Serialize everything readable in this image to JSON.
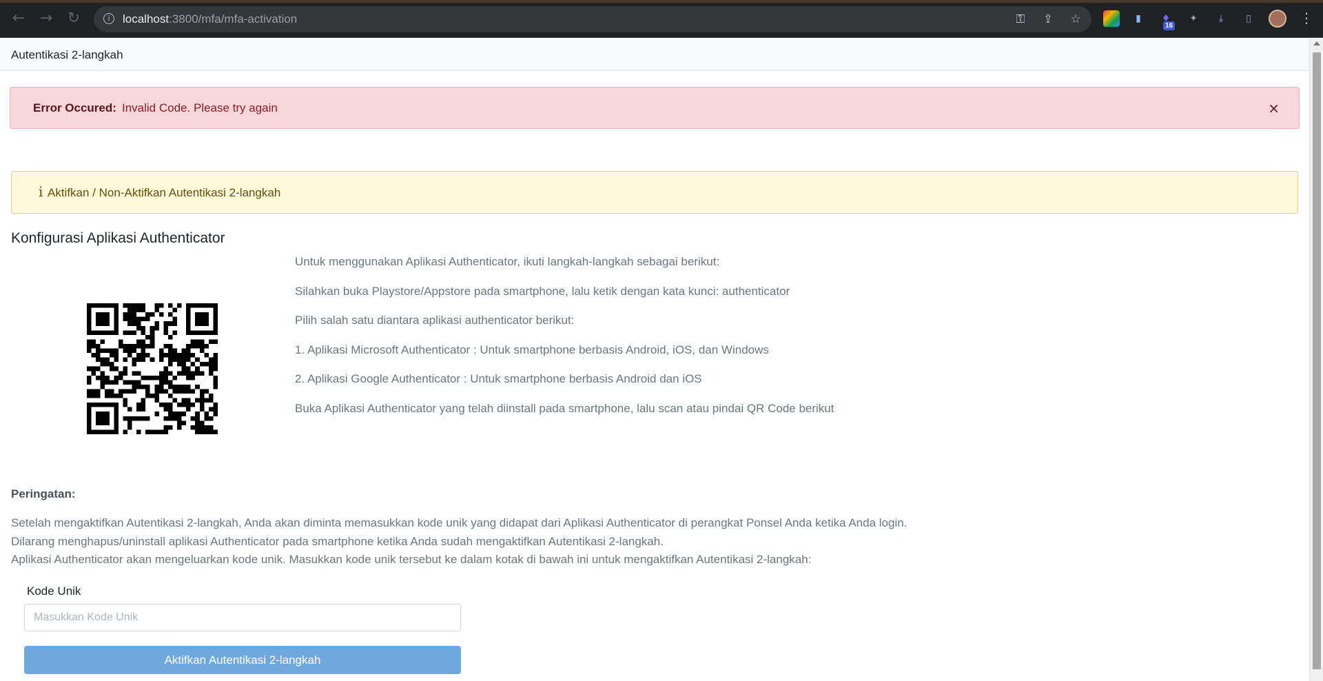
{
  "browser": {
    "url_host": "localhost",
    "url_rest": ":3800/mfa/mfa-activation",
    "extension_badge": "16"
  },
  "navbar": {
    "brand": "Autentikasi 2-langkah"
  },
  "error_alert": {
    "label": "Error Occured:",
    "message": "Invalid Code. Please try again",
    "close": "×"
  },
  "info_alert": {
    "icon": "i",
    "text": "Aktifkan / Non-Aktifkan Autentikasi 2-langkah"
  },
  "config": {
    "title": "Konfigurasi Aplikasi Authenticator",
    "instructions": [
      "Untuk menggunakan Aplikasi Authenticator, ikuti langkah-langkah sebagai berikut:",
      "Silahkan buka Playstore/Appstore pada smartphone, lalu ketik dengan kata kunci: authenticator",
      "Pilih salah satu diantara aplikasi authenticator berikut:",
      "1. Aplikasi Microsoft Authenticator : Untuk smartphone berbasis Android, iOS, dan Windows",
      "2. Aplikasi Google Authenticator : Untuk smartphone berbasis Android dan iOS",
      "Buka Aplikasi Authenticator yang telah diinstall pada smartphone, lalu scan atau pindai QR Code berikut"
    ]
  },
  "warning": {
    "title": "Peringatan:",
    "lines": [
      "Setelah mengaktifkan Autentikasi 2-langkah, Anda akan diminta memasukkan kode unik yang didapat dari Aplikasi Authenticator di perangkat Ponsel Anda ketika Anda login.",
      "Dilarang menghapus/uninstall aplikasi Authenticator pada smartphone ketika Anda sudah mengaktifkan Autentikasi 2-langkah.",
      "Aplikasi Authenticator akan mengeluarkan kode unik. Masukkan kode unik tersebut ke dalam kotak di bawah ini untuk mengaktifkan Autentikasi 2-langkah:"
    ]
  },
  "form": {
    "label": "Kode Unik",
    "placeholder": "Masukkan Kode Unik",
    "value": "",
    "submit_label": "Aktifkan Autentikasi 2-langkah"
  }
}
